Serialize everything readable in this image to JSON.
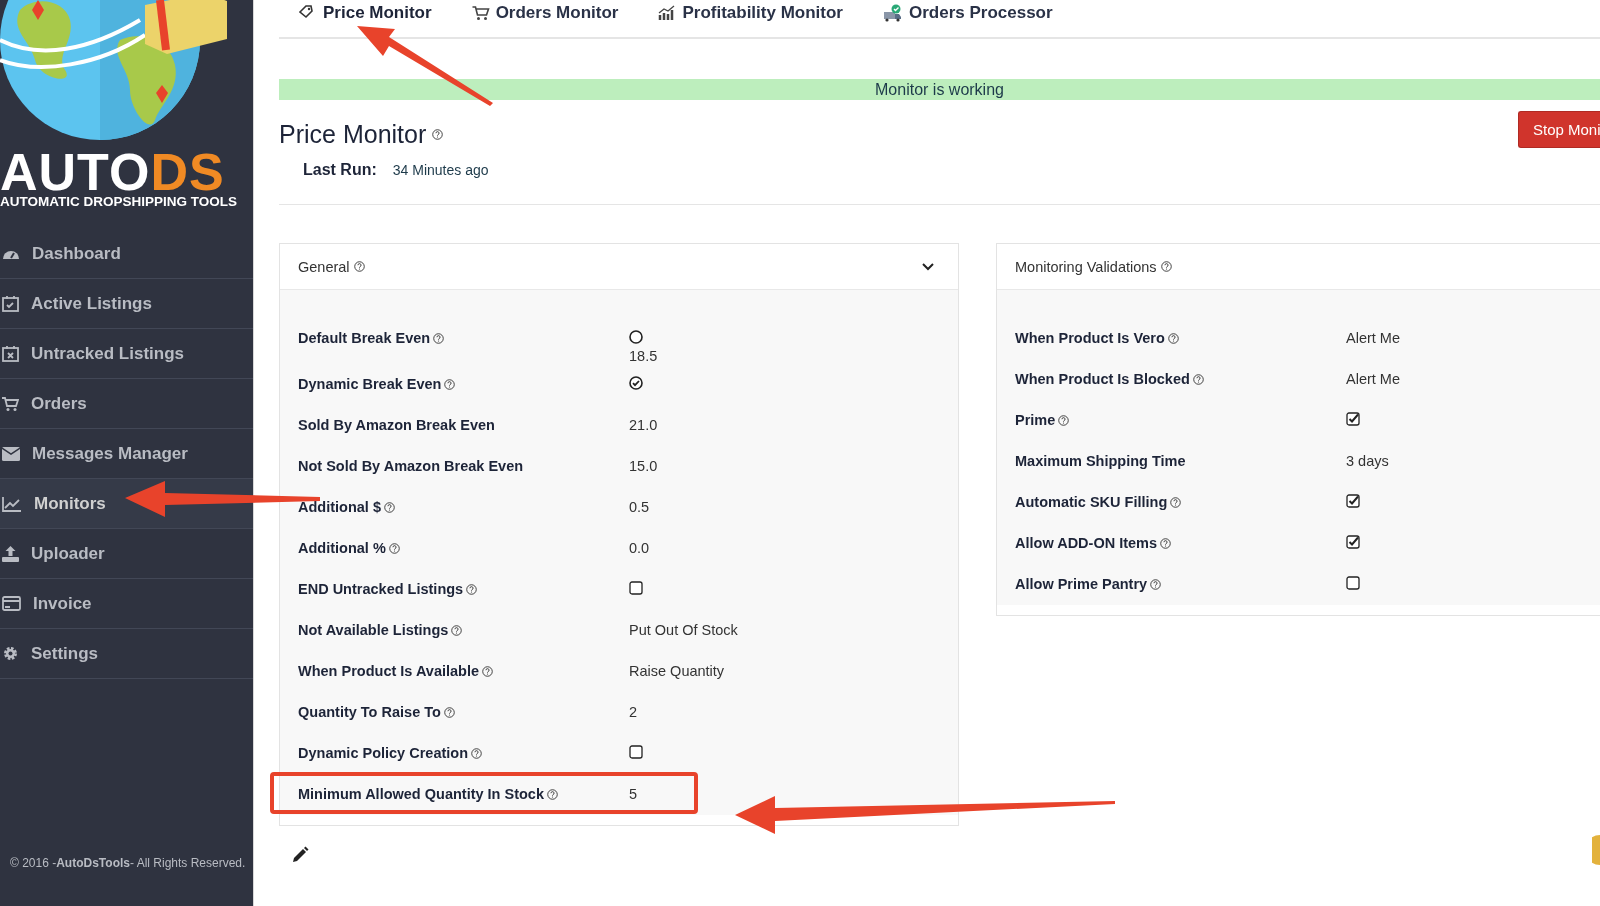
{
  "logo": {
    "word_main": "AUTO",
    "word_accent": "DS",
    "tagline": "AUTOMATIC DROPSHIPPING TOOLS"
  },
  "sidebar": {
    "items": [
      {
        "label": "Dashboard",
        "selected": false
      },
      {
        "label": "Active Listings",
        "selected": false
      },
      {
        "label": "Untracked Listings",
        "selected": false
      },
      {
        "label": "Orders",
        "selected": false
      },
      {
        "label": "Messages Manager",
        "selected": false
      },
      {
        "label": "Monitors",
        "selected": true
      },
      {
        "label": "Uploader",
        "selected": false
      },
      {
        "label": "Invoice",
        "selected": false
      },
      {
        "label": "Settings",
        "selected": false
      }
    ],
    "footer": "© 2016 -**AutoDsTools**- All Rights Reserved."
  },
  "tabs": [
    {
      "label": "Price Monitor",
      "selected": true
    },
    {
      "label": "Orders Monitor",
      "selected": false
    },
    {
      "label": "Profitability Monitor",
      "selected": false
    },
    {
      "label": "Orders Processor",
      "selected": false
    }
  ],
  "status_banner": "Monitor is working",
  "page": {
    "title": "Price Monitor",
    "last_run_label": "Last Run:",
    "last_run_value": "34 Minutes ago",
    "stop_button": "Stop Moni"
  },
  "general": {
    "title": "General",
    "expanded": true,
    "rows": [
      {
        "label": "Default Break Even",
        "help": true,
        "kind": "radio",
        "checked": false,
        "value": "18.5",
        "highlighted": false
      },
      {
        "label": "Dynamic Break Even",
        "help": true,
        "kind": "radio",
        "checked": true,
        "highlighted": false
      },
      {
        "label": "Sold By Amazon Break Even",
        "help": false,
        "kind": "text",
        "value": "21.0",
        "highlighted": false
      },
      {
        "label": "Not Sold By Amazon Break Even",
        "help": false,
        "kind": "text",
        "value": "15.0",
        "highlighted": false
      },
      {
        "label": "Additional $",
        "help": true,
        "kind": "text",
        "value": "0.5",
        "highlighted": false
      },
      {
        "label": "Additional %",
        "help": true,
        "kind": "text",
        "value": "0.0",
        "highlighted": false
      },
      {
        "label": "END Untracked Listings",
        "help": true,
        "kind": "checkbox",
        "checked": false,
        "highlighted": false
      },
      {
        "label": "Not Available Listings",
        "help": true,
        "kind": "text",
        "value": "Put Out Of Stock",
        "highlighted": false
      },
      {
        "label": "When Product Is Available",
        "help": true,
        "kind": "text",
        "value": "Raise Quantity",
        "highlighted": false
      },
      {
        "label": "Quantity To Raise To",
        "help": true,
        "kind": "text",
        "value": "2",
        "highlighted": false
      },
      {
        "label": "Dynamic Policy Creation",
        "help": true,
        "kind": "checkbox",
        "checked": false,
        "highlighted": false
      },
      {
        "label": "Minimum Allowed Quantity In Stock",
        "help": true,
        "kind": "text",
        "value": "5",
        "highlighted": true
      }
    ]
  },
  "validations": {
    "title": "Monitoring Validations",
    "rows": [
      {
        "label": "When Product Is Vero",
        "help": true,
        "kind": "text",
        "value": "Alert Me"
      },
      {
        "label": "When Product Is Blocked",
        "help": true,
        "kind": "text",
        "value": "Alert Me"
      },
      {
        "label": "Prime",
        "help": true,
        "kind": "checkbox",
        "checked": true
      },
      {
        "label": "Maximum Shipping Time",
        "help": false,
        "kind": "text",
        "value": "3 days"
      },
      {
        "label": "Automatic SKU Filling",
        "help": true,
        "kind": "checkbox",
        "checked": true
      },
      {
        "label": "Allow ADD-ON Items",
        "help": true,
        "kind": "checkbox",
        "checked": true
      },
      {
        "label": "Allow Prime Pantry",
        "help": true,
        "kind": "checkbox",
        "checked": false
      }
    ]
  }
}
